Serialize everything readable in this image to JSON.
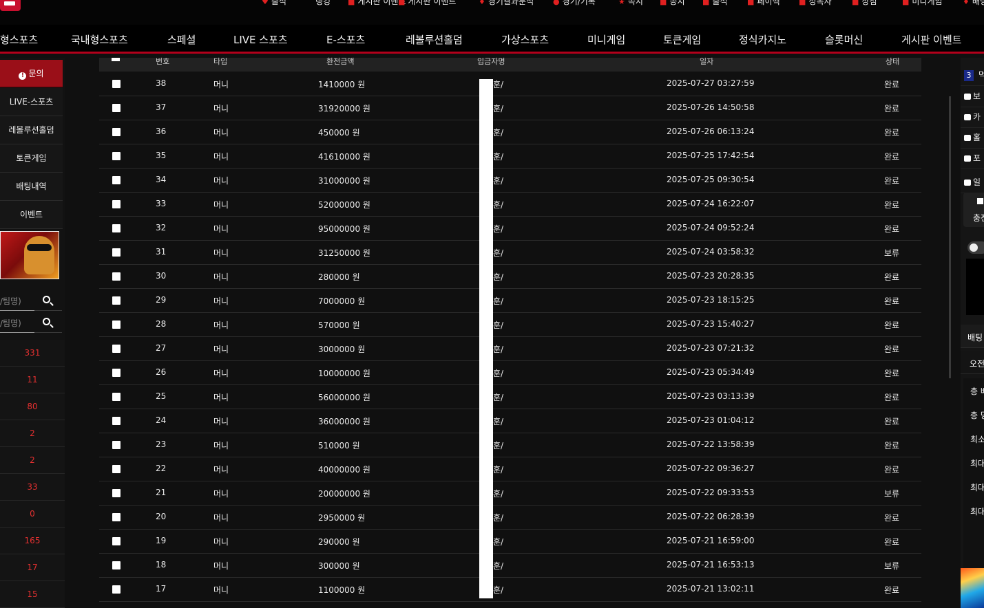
{
  "top_util": {
    "items": [
      "출석",
      "랭킹",
      "게시판 이벤트",
      "게시판 이벤트",
      "경기결과분석",
      "경기/기록",
      "쪽지",
      "공지",
      "출석",
      "페이백",
      "정복자",
      "상점",
      "미니게임",
      "배팅"
    ]
  },
  "nav": {
    "items": [
      "형스포츠",
      "국내형스포츠",
      "스페셜",
      "LIVE 스포츠",
      "E-스포츠",
      "레볼루션홀덤",
      "가상스포츠",
      "미니게임",
      "토큰게임",
      "정식카지노",
      "슬롯머신",
      "게시판 이벤트"
    ]
  },
  "sidebar": {
    "active": "문의",
    "items": [
      "LIVE-스포츠",
      "레볼루션홀덤",
      "토큰게임",
      "배팅내역",
      "이벤트"
    ],
    "search_placeholders": [
      "/팀명)",
      "/팀명)"
    ],
    "counts": [
      "331",
      "11",
      "80",
      "2",
      "2",
      "33",
      "0",
      "165",
      "17",
      "15"
    ]
  },
  "table": {
    "headers": [
      "번호",
      "타입",
      "환전금액",
      "입금자명",
      "일자",
      "상태"
    ],
    "rows": [
      {
        "no": "38",
        "type": "머니",
        "amount": "1410000 원",
        "name": "훈/",
        "date": "2025-07-27 03:27:59",
        "status": "완료"
      },
      {
        "no": "37",
        "type": "머니",
        "amount": "31920000 원",
        "name": "훈/",
        "date": "2025-07-26 14:50:58",
        "status": "완료"
      },
      {
        "no": "36",
        "type": "머니",
        "amount": "450000 원",
        "name": "훈/",
        "date": "2025-07-26 06:13:24",
        "status": "완료"
      },
      {
        "no": "35",
        "type": "머니",
        "amount": "41610000 원",
        "name": "훈/",
        "date": "2025-07-25 17:42:54",
        "status": "완료"
      },
      {
        "no": "34",
        "type": "머니",
        "amount": "31000000 원",
        "name": "훈/",
        "date": "2025-07-25 09:30:54",
        "status": "완료"
      },
      {
        "no": "33",
        "type": "머니",
        "amount": "52000000 원",
        "name": "훈/",
        "date": "2025-07-24 16:22:07",
        "status": "완료"
      },
      {
        "no": "32",
        "type": "머니",
        "amount": "95000000 원",
        "name": "훈/",
        "date": "2025-07-24 09:52:24",
        "status": "완료"
      },
      {
        "no": "31",
        "type": "머니",
        "amount": "31250000 원",
        "name": "훈/",
        "date": "2025-07-24 03:58:32",
        "status": "보류"
      },
      {
        "no": "30",
        "type": "머니",
        "amount": "280000 원",
        "name": "훈/",
        "date": "2025-07-23 20:28:35",
        "status": "완료"
      },
      {
        "no": "29",
        "type": "머니",
        "amount": "7000000 원",
        "name": "훈/",
        "date": "2025-07-23 18:15:25",
        "status": "완료"
      },
      {
        "no": "28",
        "type": "머니",
        "amount": "570000 원",
        "name": "훈/",
        "date": "2025-07-23 15:40:27",
        "status": "완료"
      },
      {
        "no": "27",
        "type": "머니",
        "amount": "3000000 원",
        "name": "훈/",
        "date": "2025-07-23 07:21:32",
        "status": "완료"
      },
      {
        "no": "26",
        "type": "머니",
        "amount": "10000000 원",
        "name": "훈/",
        "date": "2025-07-23 05:34:49",
        "status": "완료"
      },
      {
        "no": "25",
        "type": "머니",
        "amount": "56000000 원",
        "name": "훈/",
        "date": "2025-07-23 03:13:39",
        "status": "완료"
      },
      {
        "no": "24",
        "type": "머니",
        "amount": "36000000 원",
        "name": "훈/",
        "date": "2025-07-23 01:04:12",
        "status": "완료"
      },
      {
        "no": "23",
        "type": "머니",
        "amount": "510000 원",
        "name": "훈/",
        "date": "2025-07-22 13:58:39",
        "status": "완료"
      },
      {
        "no": "22",
        "type": "머니",
        "amount": "40000000 원",
        "name": "훈/",
        "date": "2025-07-22 09:36:27",
        "status": "완료"
      },
      {
        "no": "21",
        "type": "머니",
        "amount": "20000000 원",
        "name": "훈/",
        "date": "2025-07-22 09:33:53",
        "status": "보류"
      },
      {
        "no": "20",
        "type": "머니",
        "amount": "2950000 원",
        "name": "훈/",
        "date": "2025-07-22 06:28:39",
        "status": "완료"
      },
      {
        "no": "19",
        "type": "머니",
        "amount": "290000 원",
        "name": "훈/",
        "date": "2025-07-21 16:59:00",
        "status": "완료"
      },
      {
        "no": "18",
        "type": "머니",
        "amount": "300000 원",
        "name": "훈/",
        "date": "2025-07-21 16:53:13",
        "status": "보류"
      },
      {
        "no": "17",
        "type": "머니",
        "amount": "1100000 원",
        "name": "훈/",
        "date": "2025-07-21 13:02:11",
        "status": "완료"
      }
    ]
  },
  "right_panel": {
    "badge": "3",
    "badge_text": "먹",
    "links": [
      "보",
      "카",
      "홀",
      "포",
      "일"
    ],
    "charge_label": "충전",
    "section_label": "배팅",
    "section2_label": "오전",
    "summary": [
      "총 배",
      "총 당",
      "최소",
      "최대",
      "최대",
      "최대"
    ]
  },
  "colors": {
    "accent": "#b3001b",
    "accent_dark": "#9a0f18",
    "count_red": "#e53030"
  }
}
